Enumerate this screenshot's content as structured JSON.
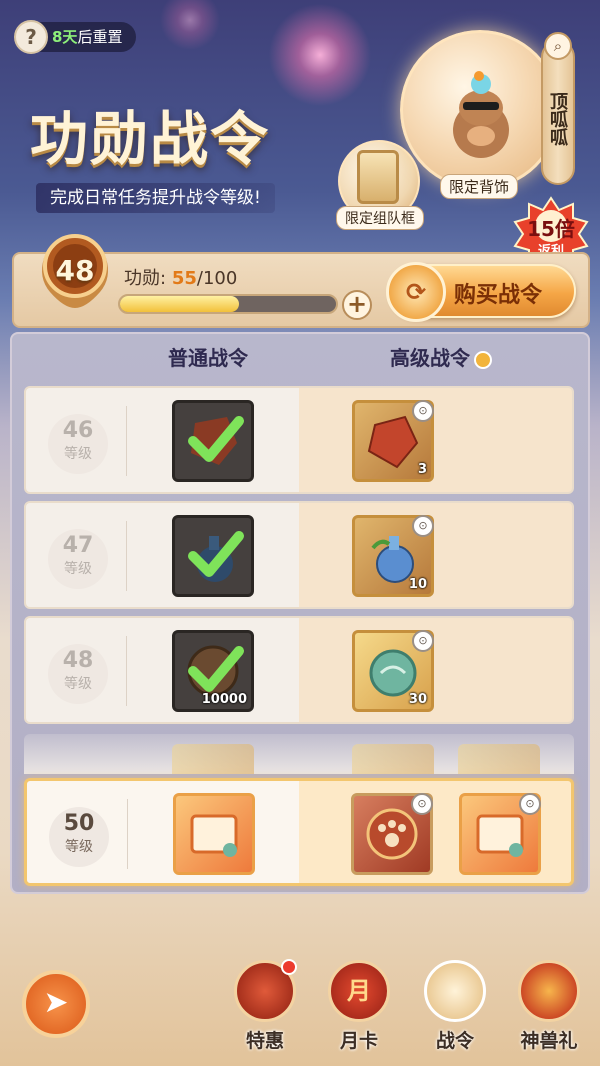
{
  "header": {
    "help_icon": "question-icon",
    "reset_days": "8天",
    "reset_suffix": "后重置",
    "title": "功勋战令",
    "subtitle": "完成日常任务提升战令等级!",
    "reward_backpiece_label": "限定背饰",
    "reward_frame_label": "限定组队框",
    "character_name": "顶呱呱",
    "bonus_multiplier": "15倍",
    "bonus_label": "返利"
  },
  "progress": {
    "level": "48",
    "merit_label": "功勋:",
    "merit_current": "55",
    "merit_total": "/100",
    "merit_fraction": 0.55,
    "buy_label": "购买战令"
  },
  "columns": {
    "normal": "普通战令",
    "premium": "高级战令"
  },
  "rows": [
    {
      "level": "46",
      "level_text": "等级",
      "normal_item": "red-crystal",
      "normal_claimed": true,
      "premium_count": "3"
    },
    {
      "level": "47",
      "level_text": "等级",
      "normal_item": "blue-potion",
      "normal_claimed": true,
      "premium_count": "10"
    },
    {
      "level": "48",
      "level_text": "等级",
      "normal_item": "coin-pile",
      "normal_claimed": true,
      "normal_count": "10000",
      "premium_count": "30"
    },
    {
      "level": "50",
      "level_text": "等级",
      "normal_item": "scroll",
      "normal_claimed": false,
      "premium_items": [
        "paw-emblem",
        "scroll"
      ]
    }
  ],
  "nav": {
    "tehui": "特惠",
    "yueka": "月卡",
    "zhanling": "战令",
    "shenshouli": "神兽礼",
    "yueka_icon_char": "月",
    "back_icon": "back-arrow-icon"
  },
  "colors": {
    "accent_orange": "#f5a646",
    "claimed_check": "#8ef07a",
    "panel_bg": "#b8b7cc"
  }
}
